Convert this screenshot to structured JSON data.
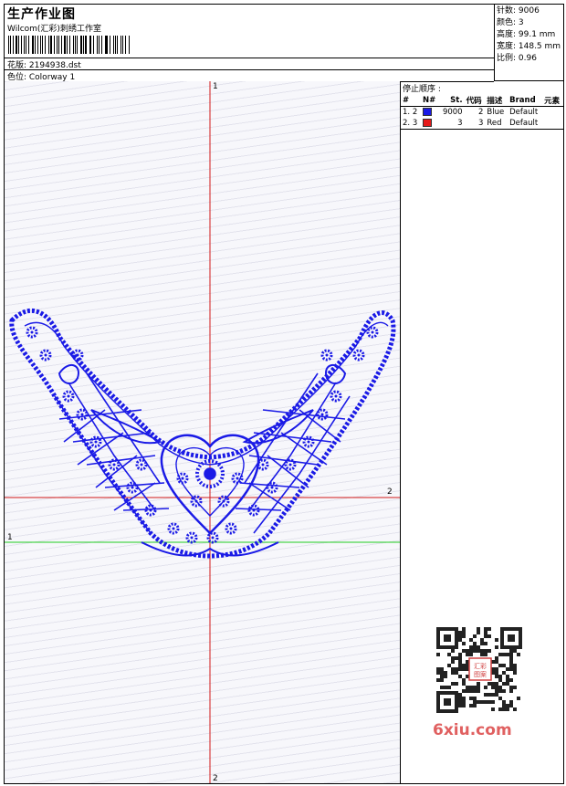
{
  "header": {
    "title": "生产作业图",
    "company": "Wilcom(汇彩)刺绣工作室",
    "design_label": "花版: 2194938.dst",
    "colorway_label": "色位: Colorway 1"
  },
  "summary": {
    "stitches": "针数: 9006",
    "colors": "颜色: 3",
    "height": "高度: 99.1 mm",
    "width": "宽度: 148.5 mm",
    "scale": "比例: 0.96"
  },
  "stop_sequence": {
    "title": "停止顺序 :",
    "columns": [
      "#",
      "N#",
      "St.",
      "代码",
      "描述",
      "Brand",
      "元素"
    ],
    "rows": [
      {
        "idx": "1.",
        "n": "2",
        "color": "#1a1ae6",
        "st": "9000",
        "code": "2",
        "desc": "Blue",
        "brand": "Default",
        "elem": ""
      },
      {
        "idx": "2.",
        "n": "3",
        "color": "#e61a1a",
        "st": "3",
        "code": "3",
        "desc": "Red",
        "brand": "Default",
        "elem": ""
      }
    ]
  },
  "axes": {
    "vertical_label_top": "1",
    "vertical_label_bottom": "2",
    "red_horizontal_label": "2",
    "green_horizontal_label": "1"
  },
  "watermark": {
    "text": "6xiu.com",
    "seal": "汇彩图案"
  },
  "colors": {
    "embroidery": "#1a1ae6",
    "axis_red": "#d01818",
    "axis_green": "#22cc22",
    "watermark": "#e06060"
  }
}
